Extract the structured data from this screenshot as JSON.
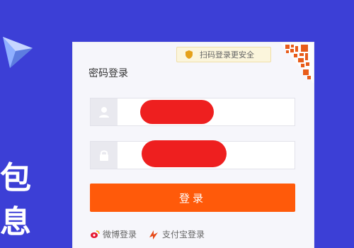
{
  "background": {
    "color": "#3c3fd6",
    "chars": [
      "包",
      "息"
    ]
  },
  "panel": {
    "title": "密码登录",
    "qr_hint": "扫码登录更安全",
    "username": {
      "placeholder": "",
      "icon": "user-icon"
    },
    "password": {
      "placeholder": "",
      "icon": "lock-icon"
    },
    "login_button": "登录",
    "weibo_label": "微博登录",
    "alipay_label": "支付宝登录"
  },
  "colors": {
    "accent": "#ff5a0a",
    "redaction": "#ee1f1f",
    "hint_bg": "#fbf5dc"
  }
}
